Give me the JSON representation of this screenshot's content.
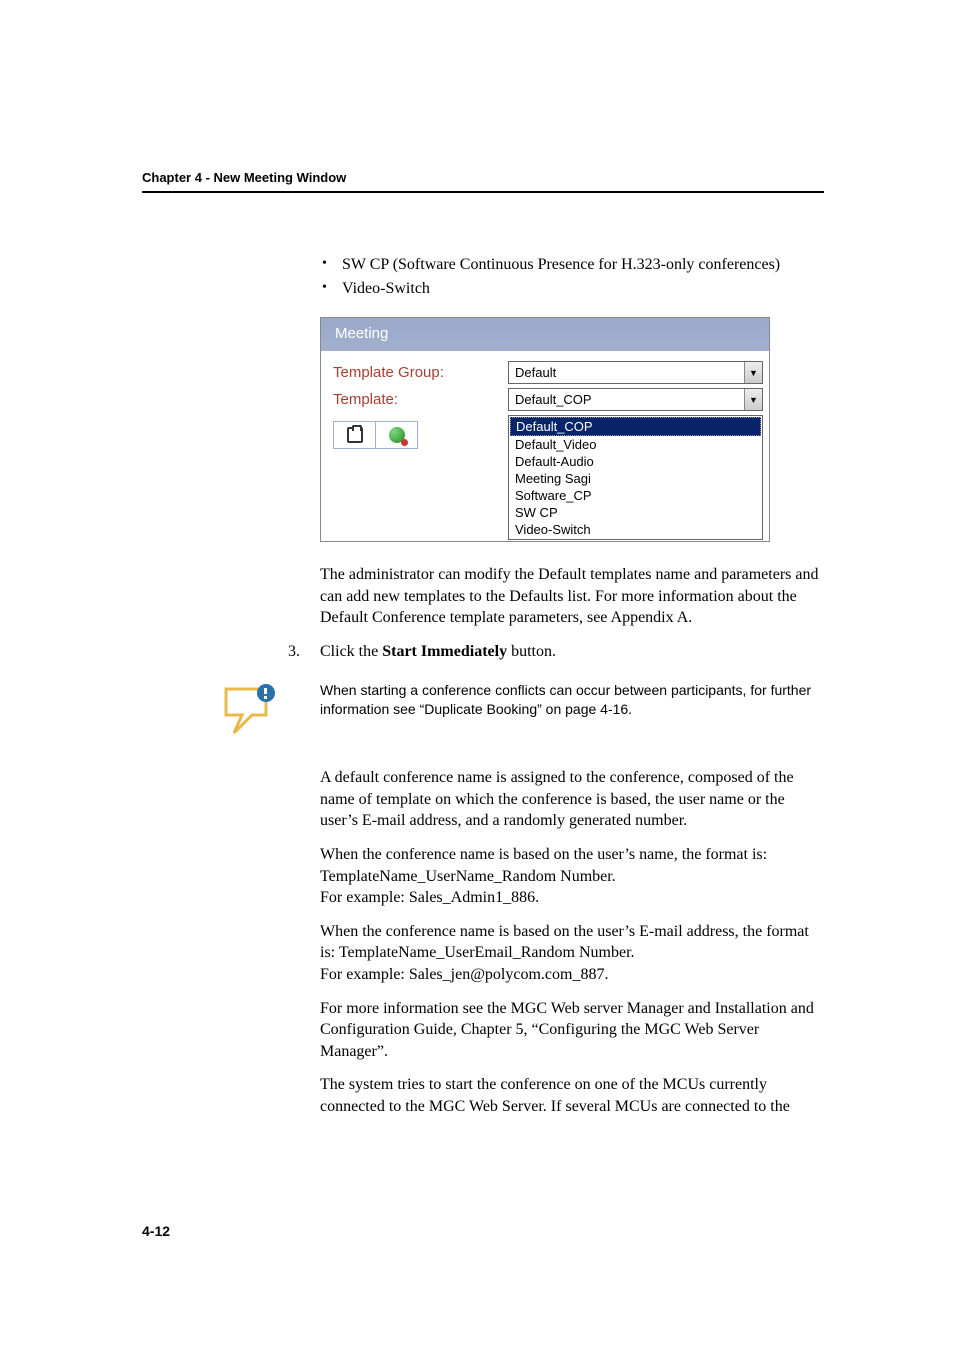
{
  "header": {
    "chapter": "Chapter 4 - New Meeting Window"
  },
  "bullets": {
    "b1": "SW CP (Software Continuous Presence for H.323-only conferences)",
    "b2": "Video-Switch"
  },
  "meeting": {
    "title": "Meeting",
    "group_label": "Template Group:",
    "group_value": "Default",
    "template_label": "Template:",
    "template_value": "Default_COP",
    "options": {
      "o0": "Default_COP",
      "o1": "Default_Video",
      "o2": "Default-Audio",
      "o3": "Meeting Sagi",
      "o4": "Software_CP",
      "o5": "SW CP",
      "o6": "Video-Switch"
    }
  },
  "para1": "The administrator can modify the Default templates name and parameters and can add new templates to the Defaults list. For more information about the Default Conference template parameters, see Appendix A.",
  "step3": {
    "num": "3.",
    "pre": "Click the ",
    "bold": "Start Immediately",
    "post": " button."
  },
  "note": "When starting a conference conflicts can occur between participants, for further information see “Duplicate Booking” on page 4-16.",
  "para2": "A default conference name is assigned to the conference, composed of the name of template on which the conference is based, the user name or the user’s E-mail address, and a randomly generated number.",
  "para3a": "When the conference name is based on the user’s name, the format is: TemplateName_UserName_Random Number.",
  "para3b": "For example: Sales_Admin1_886.",
  "para4a": "When the conference name is based on the user’s E-mail address, the format is: TemplateName_UserEmail_Random Number.",
  "para4b": "For example: Sales_jen@polycom.com_887.",
  "para5": "For more information see the MGC Web server Manager and Installation and Configuration Guide, Chapter 5, “Configuring the MGC Web Server Manager”.",
  "para6": "The system tries to start the conference on one of the MCUs currently connected to the MGC Web Server. If several MCUs are connected to the",
  "page_number": "4-12"
}
